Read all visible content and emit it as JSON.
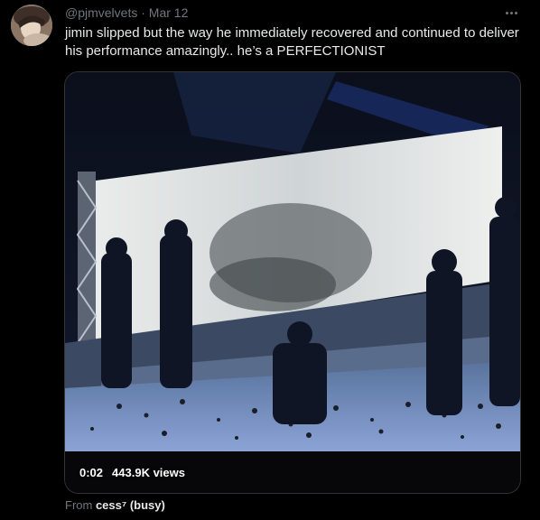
{
  "tweet": {
    "handle": "@pjmvelvets",
    "separator": " · ",
    "date": "Mar 12",
    "text_line1": "jimin slipped but the way he immediately recovered and continued to deliver",
    "text_line2": "his performance amazingly.. he’s a PERFECTIONIST"
  },
  "media": {
    "timestamp": "0:02",
    "views": "443.9K views"
  },
  "attribution": {
    "prefix": "From ",
    "author": "cess⁷ (busy)"
  },
  "colors": {
    "background": "#000000",
    "text_primary": "#e7e9ea",
    "text_secondary": "#71767b",
    "border": "#2f3336"
  },
  "icons": [
    "avatar",
    "more-icon"
  ]
}
